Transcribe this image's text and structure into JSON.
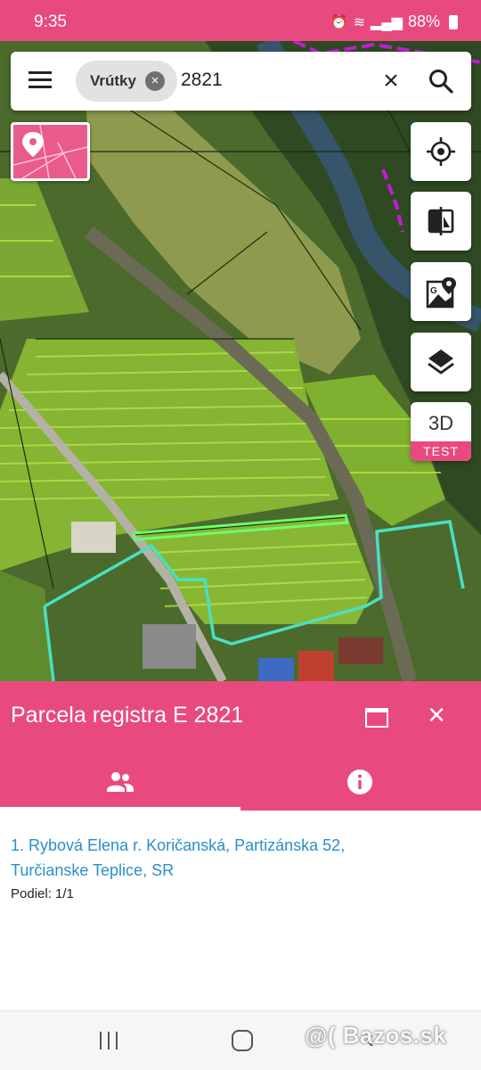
{
  "status_bar": {
    "time": "9:35",
    "battery": "88%"
  },
  "search": {
    "chip_label": "Vrútky",
    "query": "2821"
  },
  "map_controls": {
    "button_3d_label": "3D",
    "test_badge": "TEST"
  },
  "panel": {
    "title": "Parcela registra E 2821",
    "owners": [
      {
        "text": "1. Rybová Elena r. Koričanská, Partizánska 52, Turčianske Teplice, SR",
        "share": "Podiel: 1/1"
      }
    ]
  },
  "watermark": "@( Bazos.sk",
  "colors": {
    "accent": "#e84a7f",
    "link": "#2a8fc9"
  }
}
